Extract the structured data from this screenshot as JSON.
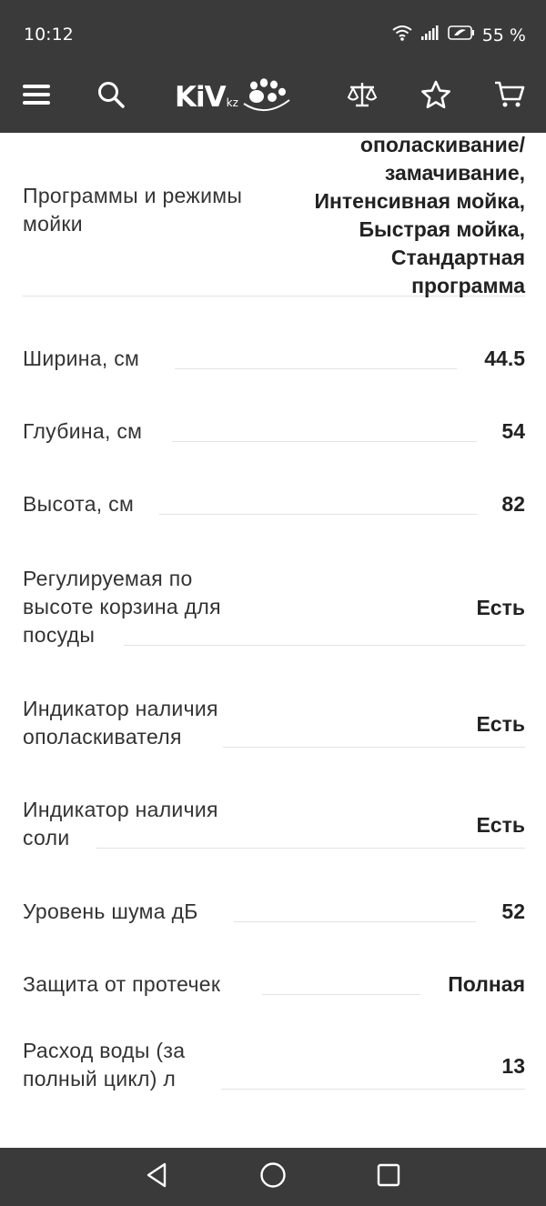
{
  "status": {
    "time": "10:12",
    "battery": "55 %"
  },
  "header": {
    "logo_main": "KiV",
    "logo_suffix": "kz"
  },
  "specs": [
    {
      "label_lines": [
        "Программы и режимы",
        "мойки"
      ],
      "value_lines": [
        "ополаскивание/",
        "замачивание,",
        "Интенсивная мойка,",
        "Быстрая мойка,",
        "Стандартная",
        "программа"
      ]
    },
    {
      "label_lines": [
        "Ширина, см"
      ],
      "value_lines": [
        "44.5"
      ]
    },
    {
      "label_lines": [
        "Глубина, см"
      ],
      "value_lines": [
        "54"
      ]
    },
    {
      "label_lines": [
        "Высота, см"
      ],
      "value_lines": [
        "82"
      ]
    },
    {
      "label_lines": [
        "Регулируемая по",
        "высоте корзина для",
        "посуды"
      ],
      "value_lines": [
        "Есть"
      ]
    },
    {
      "label_lines": [
        "Индикатор наличия",
        "ополаскивателя"
      ],
      "value_lines": [
        "Есть"
      ]
    },
    {
      "label_lines": [
        "Индикатор наличия",
        "соли"
      ],
      "value_lines": [
        "Есть"
      ]
    },
    {
      "label_lines": [
        "Уровень шума дБ"
      ],
      "value_lines": [
        "52"
      ]
    },
    {
      "label_lines": [
        "Защита от протечек"
      ],
      "value_lines": [
        "Полная"
      ]
    },
    {
      "label_lines": [
        "Расход воды (за",
        "полный цикл) л"
      ],
      "value_lines": [
        "13"
      ]
    }
  ]
}
